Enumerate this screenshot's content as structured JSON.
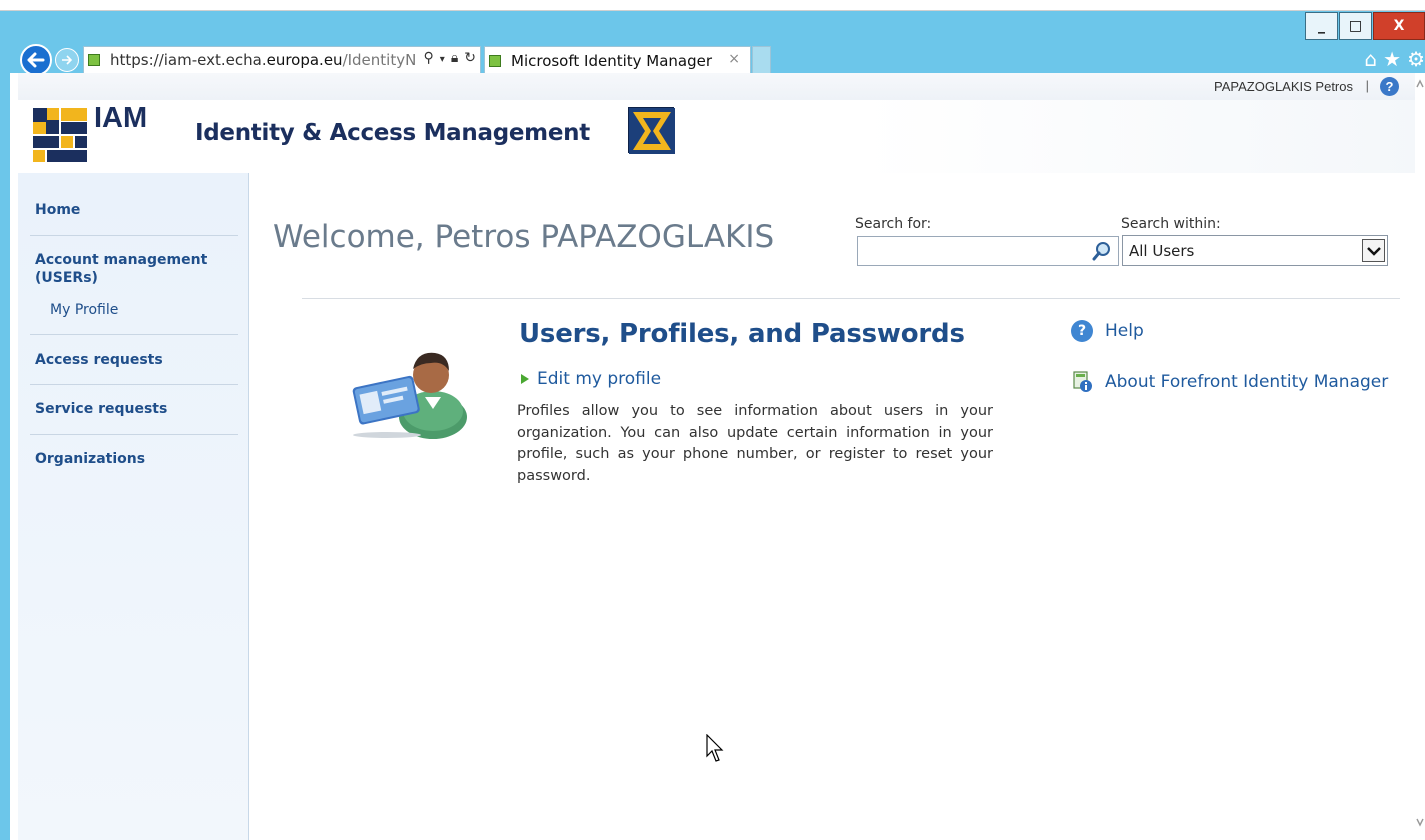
{
  "window": {
    "minimize_glyph": "_",
    "maximize_glyph": "□",
    "close_glyph": "X"
  },
  "browser": {
    "url_prefix": "https://iam-ext.echa.",
    "url_domain": "europa.eu",
    "url_path": "/IdentityN",
    "tab_title": "Microsoft Identity Manager",
    "tab_close": "×",
    "icons": [
      "back-arrow-icon",
      "forward-arrow-icon",
      "search-icon",
      "lock-icon",
      "refresh-icon",
      "home-icon",
      "favorites-star-icon",
      "settings-gear-icon"
    ]
  },
  "user_bar": {
    "user_name": "PAPAZOGLAKIS Petros",
    "separator": "|",
    "help_glyph": "?"
  },
  "header": {
    "logo_text": "IAM",
    "app_title": "Identity & Access Management",
    "logo_colors": [
      "#f2b51d",
      "#1b2f5e"
    ]
  },
  "sidebar": {
    "items": [
      {
        "label": "Home"
      },
      {
        "label": "Account management (USERs)"
      },
      {
        "label": "My Profile"
      },
      {
        "label": "Access requests"
      },
      {
        "label": "Service requests"
      },
      {
        "label": "Organizations"
      }
    ]
  },
  "main": {
    "welcome": "Welcome, Petros PAPAZOGLAKIS",
    "search": {
      "for_label": "Search for:",
      "value": "",
      "within_label": "Search within:",
      "within_selected": "All Users"
    },
    "section": {
      "title": "Users, Profiles, and Passwords",
      "edit_link": "Edit my profile",
      "description": "Profiles allow you to see information about users in your organization. You can also update certain information in your profile, such as your phone number, or register to reset your password."
    },
    "links": {
      "help": "Help",
      "about": "About Forefront Identity Manager"
    }
  },
  "colors": {
    "title_bar": "#6cc6ea",
    "nav_link": "#1f4e8a",
    "heading": "#1f4e8a",
    "welcome_text": "#6a7b8c",
    "close_button": "#d0402a"
  }
}
